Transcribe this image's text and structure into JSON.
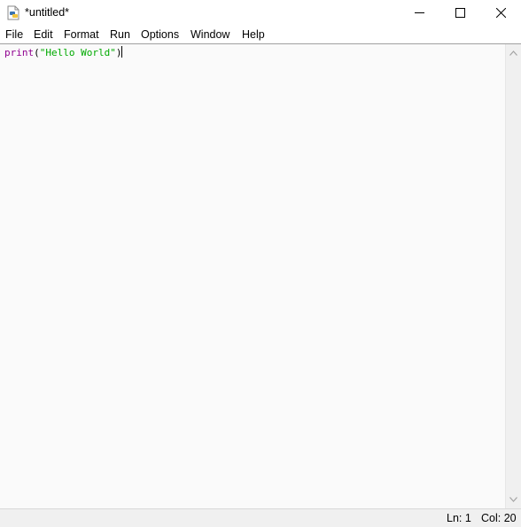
{
  "window": {
    "title": "*untitled*",
    "icon": "python-idle-icon"
  },
  "menu": {
    "items": [
      {
        "label": "File"
      },
      {
        "label": "Edit"
      },
      {
        "label": "Format"
      },
      {
        "label": "Run"
      },
      {
        "label": "Options"
      },
      {
        "label": "Window"
      },
      {
        "label": "Help"
      }
    ]
  },
  "editor": {
    "code": {
      "builtin": "print",
      "open_paren": "(",
      "string": "\"Hello World\"",
      "close_paren": ")"
    }
  },
  "status": {
    "line": "Ln: 1",
    "col": "Col: 20"
  },
  "colors": {
    "builtin": "#900090",
    "string": "#00aa00",
    "editor_bg": "#fafafa"
  }
}
